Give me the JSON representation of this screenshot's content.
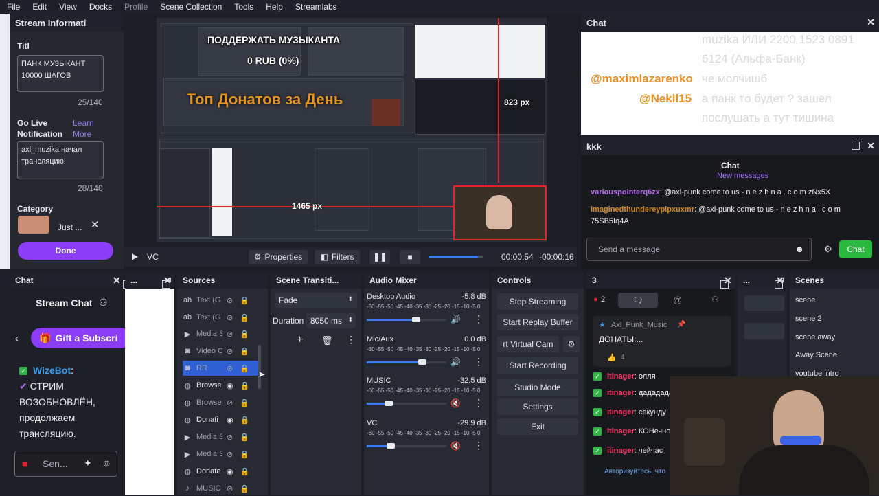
{
  "menubar": [
    "File",
    "Edit",
    "View",
    "Docks",
    "Profile",
    "Scene Collection",
    "Tools",
    "Help",
    "Streamlabs"
  ],
  "stream_info": {
    "title": "Stream Informati",
    "title_label": "Titl",
    "title_value_line1": "ПАНК МУЗЫКАНТ",
    "title_value_line2": "10000 ШАГОВ",
    "title_counter": "25/140",
    "go_live_label_1": "Go Live",
    "go_live_label_2": "Notification",
    "learn_1": "Learn",
    "learn_2": "More",
    "notif_line1": "axl_muzika начал",
    "notif_line2": "трансляцию!",
    "notif_counter": "28/140",
    "category_label": "Category",
    "category_value": "Just ...",
    "done": "Done"
  },
  "preview": {
    "donate_overlay": "ПОДДЕРЖАТЬ МУЗЫКАНТА",
    "rub_overlay": "0 RUB (0%)",
    "top_overlay": "Топ Донатов за День",
    "measure_1": "823 px",
    "measure_2": "1465 px"
  },
  "transport": {
    "source": "VC",
    "properties": "Properties",
    "filters": "Filters",
    "time_elapsed": "00:00:54",
    "time_remaining": "-00:00:16",
    "progress": 0.9
  },
  "chat_top": {
    "title": "Chat",
    "line1": "muzika ИЛИ 2200 1523 0891",
    "line2": "6124 (Альфа-Банк)",
    "name1": "@maximlazarenko",
    "msg1": "че молчишб",
    "name2": "@Nekll15",
    "msg2": "а панк то будет ? зашел",
    "msg3": "послушать а тут тишина"
  },
  "kkk": {
    "title": "kkk",
    "subtitle": "Chat",
    "new_messages": "New messages",
    "user1": "variouspointerq6zx",
    "msg1": "@axl-punk come to us - n e z h n a . c o m zNx5X",
    "user2": "imaginedthundereyplpxuxmr",
    "msg2": "@axl-punk come to us - n e z h n a . c o m",
    "msg2b": "75SB5Iq4A",
    "placeholder": "Send a message",
    "chat_btn": "Chat"
  },
  "left_chat": {
    "title": "Chat",
    "stream_chat": "Stream Chat",
    "gift": "Gift a Subscri",
    "bot": "WizeBot",
    "bot_msg1": "СТРИМ",
    "bot_msg2": "ВОЗОБНОВЛЁН,",
    "bot_msg3": "продолжаем",
    "bot_msg4": "трансляцию.",
    "send": "Sen..."
  },
  "dots_panel": "...",
  "sources": {
    "title": "Sources",
    "items": [
      "Text (G",
      "Text (G",
      "Media S",
      "Video C",
      "RR",
      "Browse",
      "Browse",
      "Donati",
      "Media S",
      "Media S",
      "Donate",
      "MUSIC"
    ]
  },
  "transitions": {
    "title": "Scene Transiti...",
    "type": "Fade",
    "duration_label": "Duration",
    "duration_value": "8050 ms"
  },
  "mixer": {
    "title": "Audio Mixer",
    "scale": "-60 -55 -50 -45 -40 -35 -30 -25 -20 -15 -10  -5  0",
    "channels": [
      {
        "name": "Desktop Audio",
        "db": "-5.8 dB",
        "level": 0.62
      },
      {
        "name": "Mic/Aux",
        "db": "0.0 dB",
        "level": 0.7
      },
      {
        "name": "MUSIC",
        "db": "-32.5 dB",
        "level": 0.28
      },
      {
        "name": "VC",
        "db": "-29.9 dB",
        "level": 0.3
      }
    ]
  },
  "controls": {
    "title": "Controls",
    "buttons": [
      "Stop Streaming",
      "Start Replay Buffer",
      "rt Virtual Cam",
      "Start Recording",
      "Studio Mode",
      "Settings",
      "Exit"
    ]
  },
  "twitch": {
    "title": "3",
    "badge": "2",
    "pinned_user": "Axl_Punk_Music",
    "pinned_msg": "ДОНАТЫ:...",
    "likes": "4",
    "user": "itinager",
    "lines": [
      "олля",
      "дададада",
      "секунду",
      "КОНечно",
      "чейчас"
    ],
    "login_text": "Авторизуйтесь, что"
  },
  "scenes": {
    "title": "Scenes",
    "items": [
      "scene",
      "scene 2",
      "scene away",
      "Away Scene",
      "youtube intro"
    ]
  },
  "colors": {
    "accent": "#8b3df7",
    "twitch_chat": "#35b34a",
    "obs_blue": "#3c7bf2"
  }
}
